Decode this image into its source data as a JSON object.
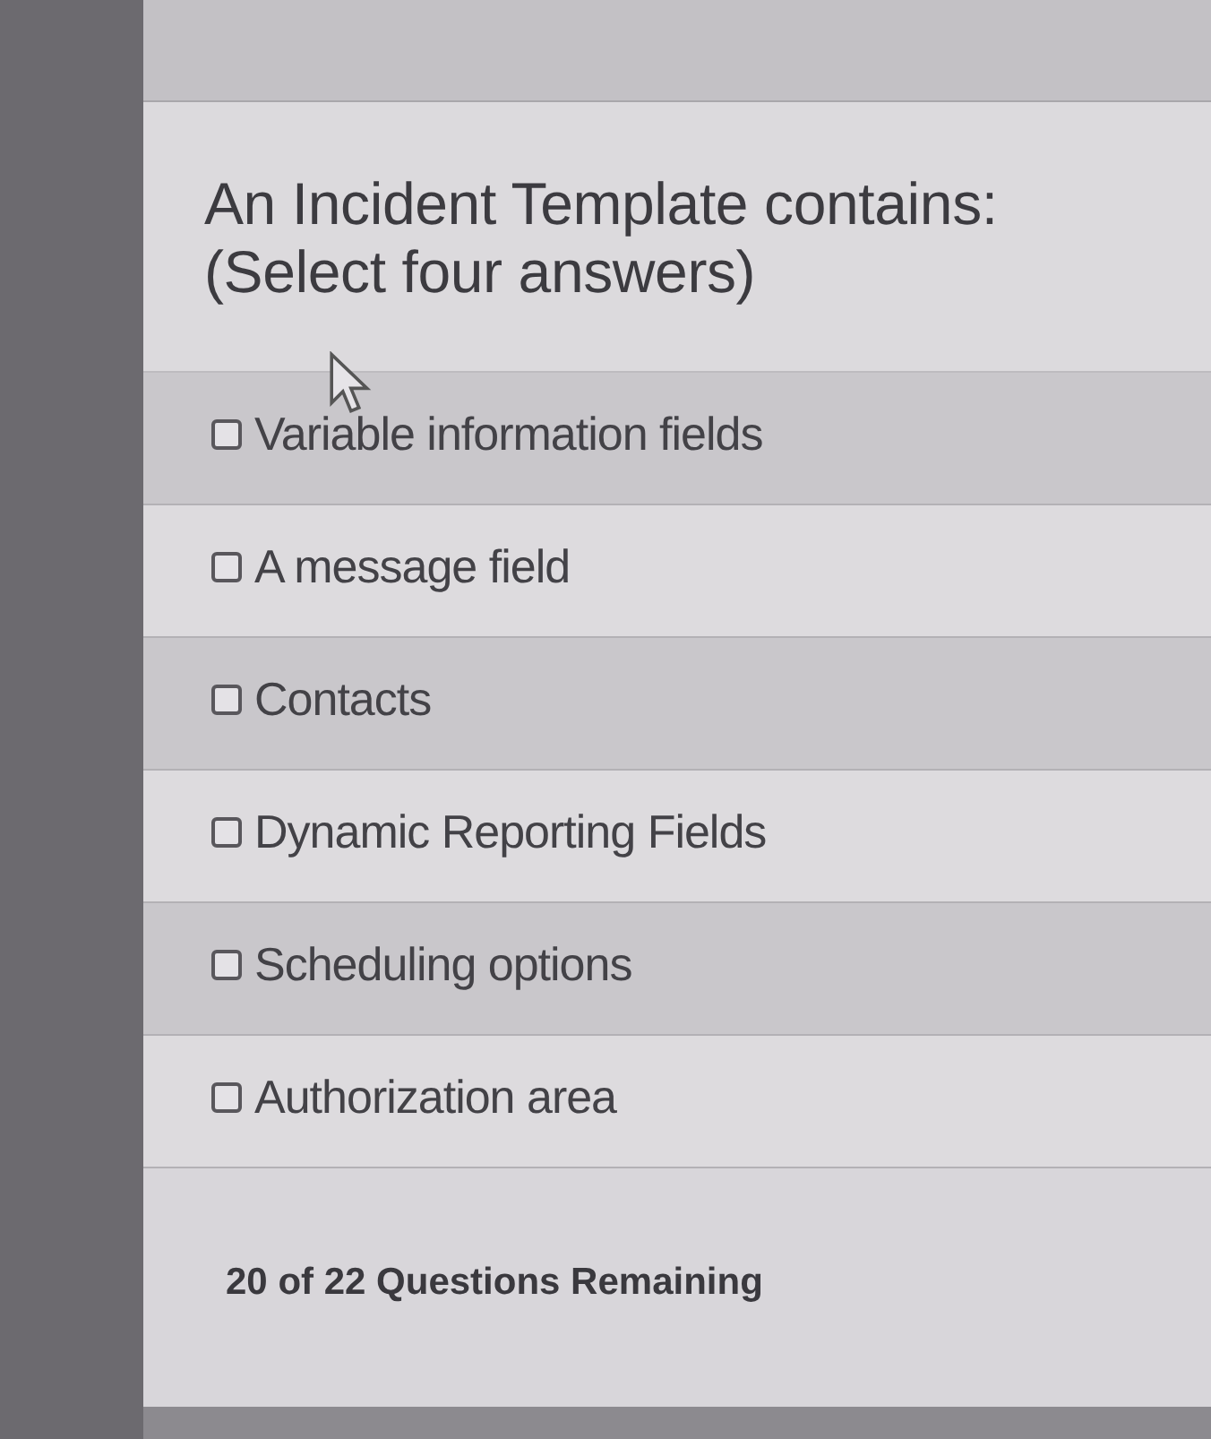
{
  "question": {
    "text": "An Incident Template contains:",
    "instruction": "(Select four answers)"
  },
  "options": [
    {
      "label": "Variable information fields",
      "checked": false
    },
    {
      "label": "A message field",
      "checked": false
    },
    {
      "label": "Contacts",
      "checked": false
    },
    {
      "label": "Dynamic Reporting Fields",
      "checked": false
    },
    {
      "label": "Scheduling options",
      "checked": false
    },
    {
      "label": "Authorization area",
      "checked": false
    }
  ],
  "footer": {
    "progress": "20 of 22 Questions Remaining"
  }
}
